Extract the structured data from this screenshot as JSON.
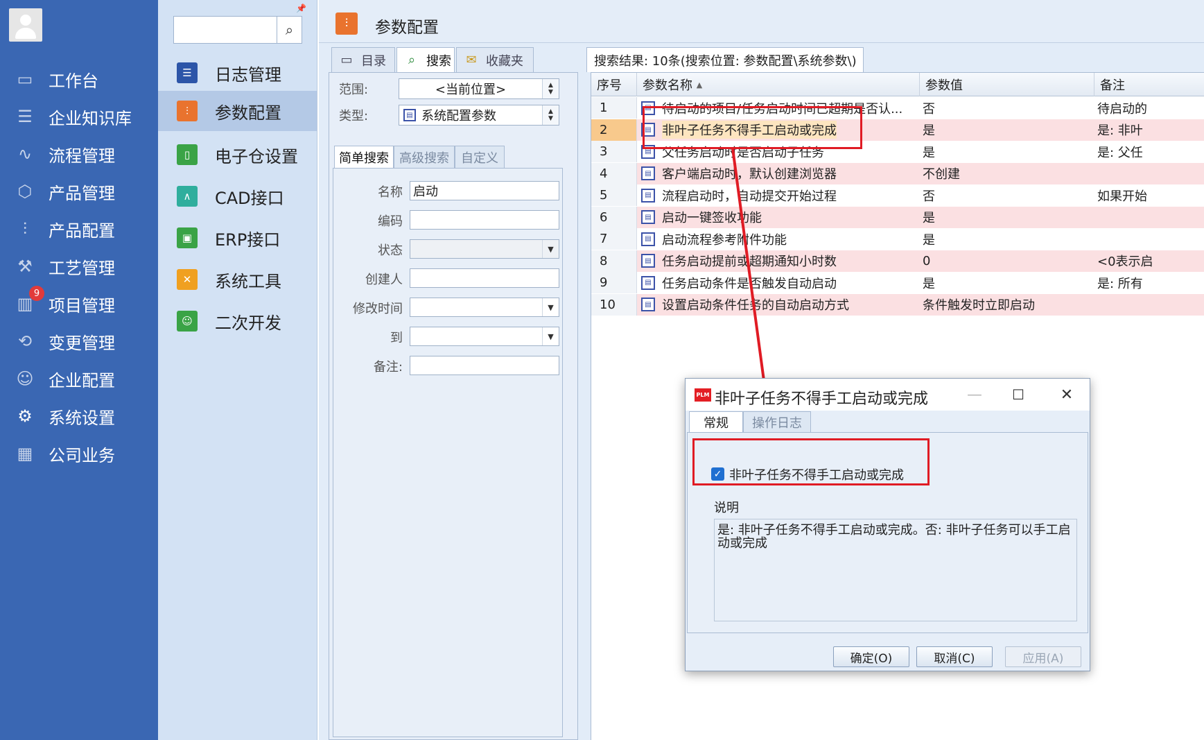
{
  "sidebar": {
    "items": [
      {
        "label": "工作台",
        "icon": "monitor-icon"
      },
      {
        "label": "企业知识库",
        "icon": "list-icon"
      },
      {
        "label": "流程管理",
        "icon": "flow-icon"
      },
      {
        "label": "产品管理",
        "icon": "cube-icon"
      },
      {
        "label": "产品配置",
        "icon": "sliders-icon"
      },
      {
        "label": "工艺管理",
        "icon": "wrench-icon"
      },
      {
        "label": "项目管理",
        "icon": "chart-icon",
        "badge": "9"
      },
      {
        "label": "变更管理",
        "icon": "change-icon"
      },
      {
        "label": "企业配置",
        "icon": "users-icon"
      },
      {
        "label": "系统设置",
        "icon": "gear-icon"
      },
      {
        "label": "公司业务",
        "icon": "grid-icon"
      }
    ]
  },
  "subpanel": {
    "search_value": "",
    "items": [
      {
        "label": "日志管理",
        "icon": "log-icon",
        "color": "#2c55a8"
      },
      {
        "label": "参数配置",
        "icon": "sliders-icon",
        "color": "#e9732e"
      },
      {
        "label": "电子仓设置",
        "icon": "storage-icon",
        "color": "#3aa346"
      },
      {
        "label": "CAD接口",
        "icon": "cad-icon",
        "color": "#2fae9d"
      },
      {
        "label": "ERP接口",
        "icon": "erp-icon",
        "color": "#3aa346"
      },
      {
        "label": "系统工具",
        "icon": "tools-icon",
        "color": "#f0a020"
      },
      {
        "label": "二次开发",
        "icon": "dev-icon",
        "color": "#3aa346"
      }
    ]
  },
  "main": {
    "title": "参数配置",
    "tabs": [
      {
        "label": "目录",
        "icon": "directory-icon"
      },
      {
        "label": "搜索",
        "icon": "search-icon"
      },
      {
        "label": "收藏夹",
        "icon": "favorites-icon"
      }
    ],
    "scope_label": "范围:",
    "scope_value": "<当前位置>",
    "type_label": "类型:",
    "type_value": "系统配置参数",
    "search_tabs": [
      "简单搜索",
      "高级搜索",
      "自定义"
    ],
    "fields": {
      "name_label": "名称",
      "name_value": "启动",
      "code_label": "编码",
      "code_value": "",
      "status_label": "状态",
      "creator_label": "创建人",
      "modified_label": "修改时间",
      "to_label": "到",
      "note_label": "备注:"
    }
  },
  "results": {
    "header": "搜索结果: 10条(搜索位置: 参数配置\\系统参数\\)",
    "columns": [
      "序号",
      "参数名称",
      "参数值",
      "备注"
    ],
    "sort_indicator": "▲",
    "rows": [
      {
        "no": "1",
        "name": "待启动的项目/任务启动时间已超期是否认...",
        "value": "否",
        "note": "待启动的"
      },
      {
        "no": "2",
        "name": "非叶子任务不得手工启动或完成",
        "value": "是",
        "note": "是: 非叶"
      },
      {
        "no": "3",
        "name": "父任务启动时是否启动子任务",
        "value": "是",
        "note": "是: 父任"
      },
      {
        "no": "4",
        "name": "客户端启动时，默认创建浏览器",
        "value": "不创建",
        "note": ""
      },
      {
        "no": "5",
        "name": "流程启动时，自动提交开始过程",
        "value": "否",
        "note": "如果开始"
      },
      {
        "no": "6",
        "name": "启动一键签收功能",
        "value": "是",
        "note": ""
      },
      {
        "no": "7",
        "name": "启动流程参考附件功能",
        "value": "是",
        "note": ""
      },
      {
        "no": "8",
        "name": "任务启动提前或超期通知小时数",
        "value": "0",
        "note": "<0表示启"
      },
      {
        "no": "9",
        "name": "任务启动条件是否触发自动启动",
        "value": "是",
        "note": "是: 所有"
      },
      {
        "no": "10",
        "name": "设置启动条件任务的自动启动方式",
        "value": "条件触发时立即启动",
        "note": ""
      }
    ]
  },
  "dialog": {
    "app_icon_text": "PLM",
    "title": "非叶子任务不得手工启动或完成",
    "tabs": [
      "常规",
      "操作日志"
    ],
    "checkbox_label": "非叶子任务不得手工启动或完成",
    "checkbox_checked": true,
    "desc_label": "说明",
    "description": "是: 非叶子任务不得手工启动或完成。否: 非叶子任务可以手工启动或完成",
    "buttons": {
      "ok": "确定(O)",
      "cancel": "取消(C)",
      "apply": "应用(A)"
    }
  },
  "colors": {
    "sidebar": "#3a67b3",
    "annotation": "#e01b24",
    "row_highlight": "#fbe0e2",
    "accent": "#e9732e"
  }
}
